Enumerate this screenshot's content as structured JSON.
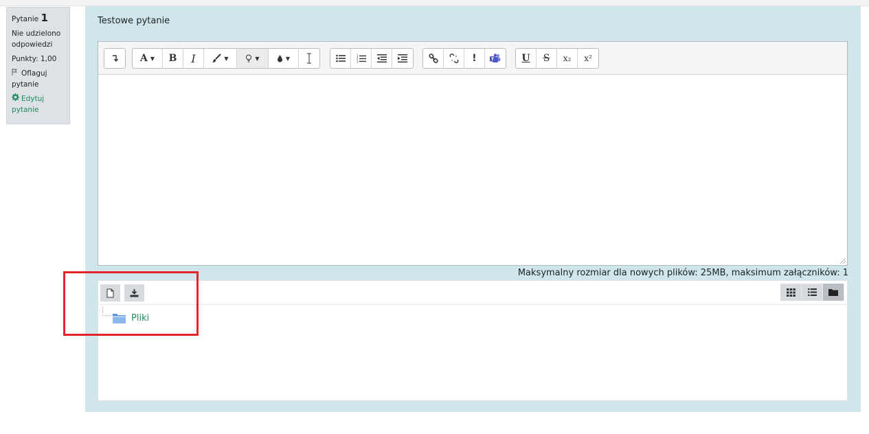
{
  "question_info": {
    "question_label": "Pytanie",
    "question_number": "1",
    "status": "Nie udzielono odpowiedzi",
    "points": "Punkty: 1,00",
    "flag_label": "Oflaguj pytanie",
    "edit_label": "Edytuj pytanie"
  },
  "question_text": "Testowe pytanie",
  "toolbar": {
    "font_button_label": "A",
    "bold_label": "B",
    "italic_label": "I",
    "underline_label": "U",
    "strike_label": "S",
    "subscript_label": "x₂",
    "superscript_label": "x²",
    "accessibility_label": "!"
  },
  "max_info": "Maksymalny rozmiar dla nowych plików: 25MB, maksimum załączników: 1",
  "file_manager": {
    "folder_name": "Pliki"
  },
  "colors": {
    "accent_green": "#1f8a5c",
    "content_bg": "#cfe6ea",
    "highlight_red": "#e3242b"
  }
}
